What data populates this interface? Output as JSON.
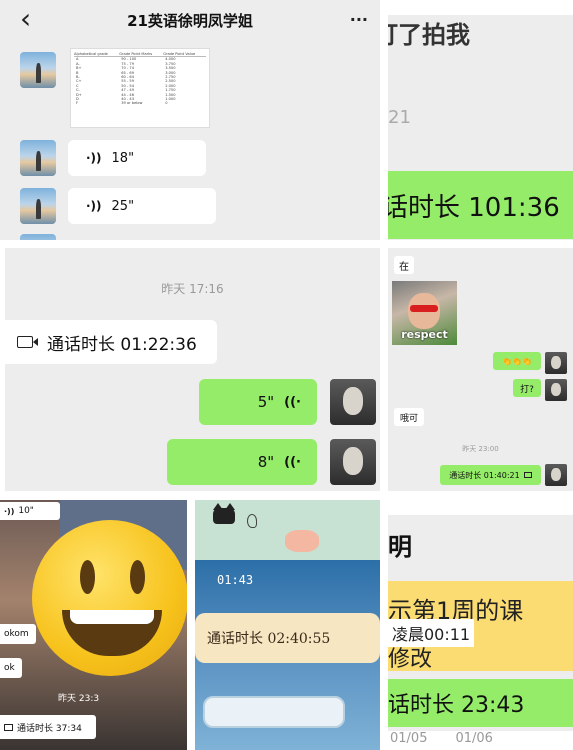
{
  "p1": {
    "title": "21英语徐明凤学姐",
    "back_glyph": "‹",
    "more_glyph": "···",
    "grade_table": {
      "headers": [
        "Alphabetical grade",
        "Grade Point Marks",
        "Grade Point Value"
      ],
      "rows": [
        [
          "A",
          "90 - 100",
          "4.000"
        ],
        [
          "A-",
          "75 - 79",
          "3.750"
        ],
        [
          "B+",
          "70 - 74",
          "3.500"
        ],
        [
          "B",
          "65 - 69",
          "3.000"
        ],
        [
          "B-",
          "60 - 64",
          "2.750"
        ],
        [
          "C+",
          "55 - 59",
          "2.500"
        ],
        [
          "C",
          "50 - 54",
          "2.000"
        ],
        [
          "C-",
          "47 - 49",
          "1.750"
        ],
        [
          "D+",
          "44 - 46",
          "1.500"
        ],
        [
          "D",
          "40 - 43",
          "1.000"
        ],
        [
          "F",
          "39 or below",
          "0"
        ]
      ]
    },
    "voice1": "18\"",
    "voice2": "25\""
  },
  "p2": {
    "top_text": "打了拍我",
    "num": "21",
    "call": "话时长 101:36"
  },
  "p3": {
    "timestamp": "昨天 17:16",
    "call": "通话时长 01:22:36",
    "voice1": "5\"",
    "voice2": "8\""
  },
  "p4": {
    "msg_zai": "在",
    "sticker_text": "respect",
    "emoji": "👏👏👏",
    "msg_da": "打?",
    "msg_ok": "哦可",
    "timestamp": "昨天 23:00",
    "call": "通话时长 01:40:21"
  },
  "p5": {
    "voice": "10\"",
    "text1": "okom",
    "text2": "ok",
    "timestamp": "昨天 23:3",
    "call": "通话时长 37:34"
  },
  "p6": {
    "time": "01:43",
    "call": "通话时长 02:40:55"
  },
  "p7": {
    "top": "明",
    "line1": "示第1周的课",
    "line2": "凌晨00:11",
    "line3": "修改",
    "call": "话时长 23:43",
    "dates": [
      "01/05",
      "01/06"
    ]
  },
  "colors": {
    "wechat_green": "#95ec69",
    "bg_gray": "#ededed",
    "time_gray": "#9a9a9a",
    "emoji_yellow": "#f7c21b"
  }
}
